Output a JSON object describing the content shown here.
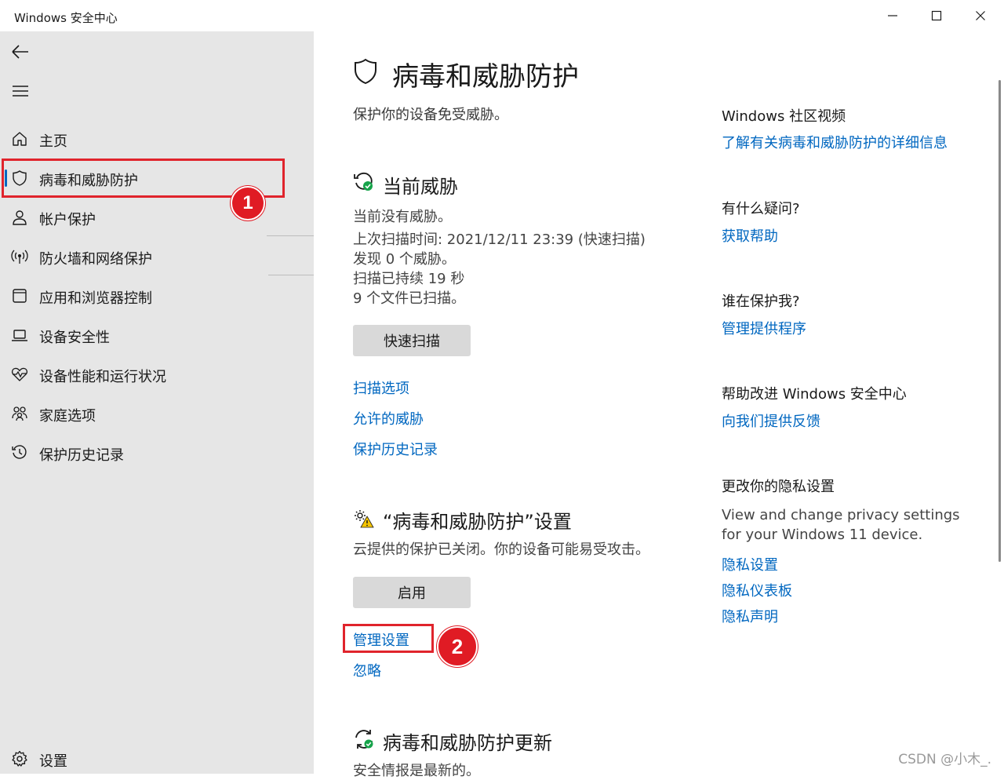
{
  "window": {
    "title": "Windows 安全中心"
  },
  "sidebar": {
    "items": [
      {
        "label": "主页",
        "icon": "home-icon"
      },
      {
        "label": "病毒和威胁防护",
        "icon": "shield-icon"
      },
      {
        "label": "帐户保护",
        "icon": "person-icon"
      },
      {
        "label": "防火墙和网络保护",
        "icon": "wireless-icon"
      },
      {
        "label": "应用和浏览器控制",
        "icon": "app-window-icon"
      },
      {
        "label": "设备安全性",
        "icon": "laptop-icon"
      },
      {
        "label": "设备性能和运行状况",
        "icon": "heart-pulse-icon"
      },
      {
        "label": "家庭选项",
        "icon": "family-icon"
      },
      {
        "label": "保护历史记录",
        "icon": "history-icon"
      }
    ],
    "settings_label": "设置"
  },
  "annotations": {
    "badge1": "1",
    "badge2": "2"
  },
  "main": {
    "title": "病毒和威胁防护",
    "subtitle": "保护你的设备免受威胁。",
    "threats": {
      "title": "当前威胁",
      "lines": [
        "当前没有威胁。",
        "上次扫描时间: 2021/12/11 23:39 (快速扫描)",
        "发现 0 个威胁。",
        "扫描已持续 19 秒",
        "9 个文件已扫描。"
      ],
      "scan_button": "快速扫描",
      "links": [
        "扫描选项",
        "允许的威胁",
        "保护历史记录"
      ]
    },
    "settings": {
      "title": "“病毒和威胁防护”设置",
      "desc": "云提供的保护已关闭。你的设备可能易受攻击。",
      "enable_button": "启用",
      "manage_link": "管理设置",
      "dismiss_link": "忽略"
    },
    "updates": {
      "title": "病毒和威胁防护更新",
      "desc": "安全情报是最新的。"
    }
  },
  "right": {
    "community": {
      "heading": "Windows 社区视频",
      "link": "了解有关病毒和威胁防护的详细信息"
    },
    "question": {
      "heading": "有什么疑问?",
      "link": "获取帮助"
    },
    "who": {
      "heading": "谁在保护我?",
      "link": "管理提供程序"
    },
    "improve": {
      "heading": "帮助改进 Windows 安全中心",
      "link": "向我们提供反馈"
    },
    "privacy": {
      "heading": "更改你的隐私设置",
      "text1": "View and change privacy settings",
      "text2": "for your Windows 11 device.",
      "links": [
        "隐私设置",
        "隐私仪表板",
        "隐私声明"
      ]
    }
  },
  "watermark": "CSDN @小木_.",
  "colors": {
    "accent": "#0067c0",
    "highlight": "#e0242c",
    "sidebar_bg": "#e6e6e6"
  }
}
